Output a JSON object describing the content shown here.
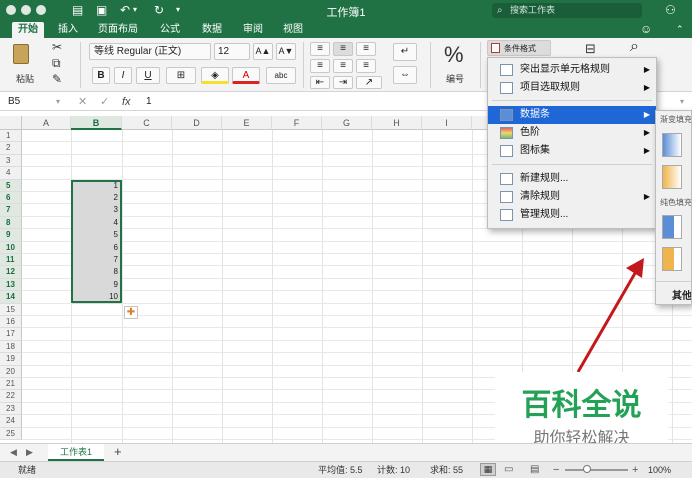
{
  "window": {
    "title": "工作簿1",
    "search_placeholder": "搜索工作表",
    "accent_color": "#217346"
  },
  "ribbon_tabs": [
    "开始",
    "插入",
    "页面布局",
    "公式",
    "数据",
    "审阅",
    "视图"
  ],
  "ribbon": {
    "paste_label": "粘贴",
    "font_name": "等线 Regular (正文)",
    "font_size": "12",
    "bold": "B",
    "italic": "I",
    "underline": "U",
    "font_color_glyph": "A",
    "grow_font": "A▲",
    "shrink_font": "A▼",
    "number_label": "编号",
    "percent_glyph": "%",
    "cond_format_label": "条件格式"
  },
  "formula_bar": {
    "cell_ref": "B5",
    "fx": "fx",
    "value": "1"
  },
  "columns": [
    "A",
    "B",
    "C",
    "D",
    "E",
    "F",
    "G",
    "H",
    "I"
  ],
  "rows": [
    "1",
    "2",
    "3",
    "4",
    "5",
    "6",
    "7",
    "8",
    "9",
    "10",
    "11",
    "12",
    "13",
    "14",
    "15",
    "16",
    "17",
    "18",
    "19",
    "20",
    "21",
    "22",
    "23",
    "24",
    "25"
  ],
  "cells_b": [
    "1",
    "2",
    "3",
    "4",
    "5",
    "6",
    "7",
    "8",
    "9",
    "10"
  ],
  "cond_menu": {
    "items": [
      {
        "label": "突出显示单元格规则",
        "arrow": "▶"
      },
      {
        "label": "项目选取规则",
        "arrow": "▶"
      },
      {
        "label": "数据条",
        "arrow": "▶"
      },
      {
        "label": "色阶",
        "arrow": "▶"
      },
      {
        "label": "图标集",
        "arrow": "▶"
      },
      {
        "label": "新建规则..."
      },
      {
        "label": "清除规则",
        "arrow": "▶"
      },
      {
        "label": "管理规则..."
      }
    ]
  },
  "submenu": {
    "gradient_label": "渐变填充",
    "solid_label": "纯色填充",
    "more_label": "其他规则..."
  },
  "watermark": {
    "title": "百科全说",
    "subtitle": "助你轻松解决"
  },
  "sheet_tab": "工作表1",
  "add_sheet": "+",
  "status": {
    "mode": "就绪",
    "average": "平均值: 5.5",
    "count": "计数: 10",
    "sum": "求和: 55",
    "zoom": "100%"
  }
}
